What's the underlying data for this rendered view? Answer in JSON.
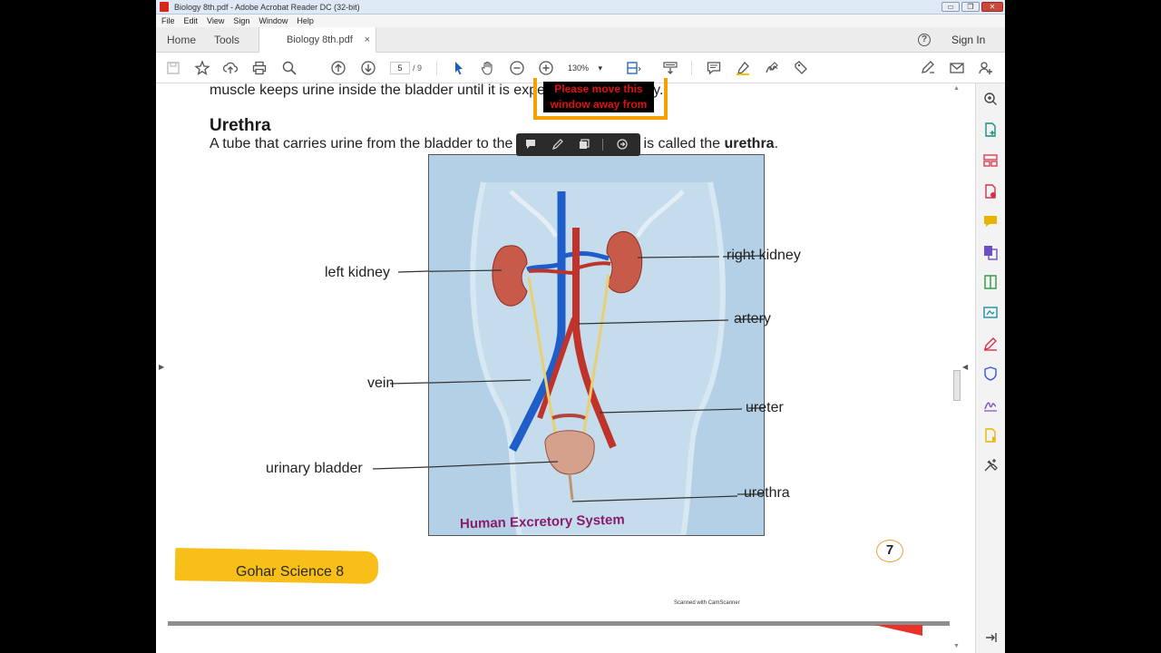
{
  "window": {
    "title": "Biology 8th.pdf - Adobe Acrobat Reader DC (32-bit)",
    "controls": {
      "minimize": "▭",
      "restore": "❐",
      "close": "✕"
    }
  },
  "menu": [
    "File",
    "Edit",
    "View",
    "Sign",
    "Window",
    "Help"
  ],
  "tabs": {
    "home": "Home",
    "tools": "Tools",
    "document": "Biology 8th.pdf",
    "close_glyph": "×"
  },
  "header": {
    "signin": "Sign In",
    "help_glyph": "?"
  },
  "toolbar": {
    "current_page": "5",
    "page_total": "/ 9",
    "zoom": "130%",
    "icons": [
      "save-icon",
      "star-icon",
      "upload-icon",
      "print-icon",
      "find-icon",
      "page-up-icon",
      "page-down-icon",
      "select-icon",
      "hand-icon",
      "zoom-out-icon",
      "zoom-in-icon",
      "fit-page-icon",
      "scroll-mode-icon",
      "comment-icon",
      "highlight-icon",
      "sign-icon",
      "stamp-icon",
      "edit-fill-icon",
      "email-icon",
      "share-user-icon"
    ]
  },
  "document": {
    "line1": "muscle keeps urine inside the bladder until it is expelled from the body.",
    "heading": "Urethra",
    "sentence_pre": "A tube that carries urine from the bladder to the outside of the body is called the ",
    "sentence_bold": "urethra",
    "sentence_post": ".",
    "diagram_caption": "Human Excretory System",
    "labels": {
      "left_kidney": "left kidney",
      "right_kidney": "right kidney",
      "artery": "artery",
      "vein": "vein",
      "ureter": "ureter",
      "urinary_bladder": "urinary bladder",
      "urethra": "urethra"
    },
    "footer_banner": "Gohar Science 8",
    "page_number": "7",
    "scanner_note": "Scanned with CamScanner"
  },
  "overlay_notice": "Please move this window away from",
  "annotation_toolbar": {
    "icons": [
      "sticky-note-icon",
      "pen-icon",
      "copy-icon",
      "more-options-icon"
    ]
  },
  "right_panel": {
    "icons": [
      "zoom-search-icon",
      "create-pdf-icon",
      "organize-pages-icon",
      "export-pdf-icon",
      "comment-tool-icon",
      "combine-files-icon",
      "compress-icon",
      "convert-icon",
      "fill-sign-icon",
      "protect-icon",
      "signature-icon",
      "send-review-icon",
      "more-tools-icon",
      "collapse-panel-icon"
    ]
  },
  "colors": {
    "accent_orange": "#f5a200",
    "warning_red": "#e01010",
    "banner_yellow": "#f7bf18",
    "diagram_bg": "#b3d0e6",
    "caption_purple": "#8a1c6c"
  }
}
